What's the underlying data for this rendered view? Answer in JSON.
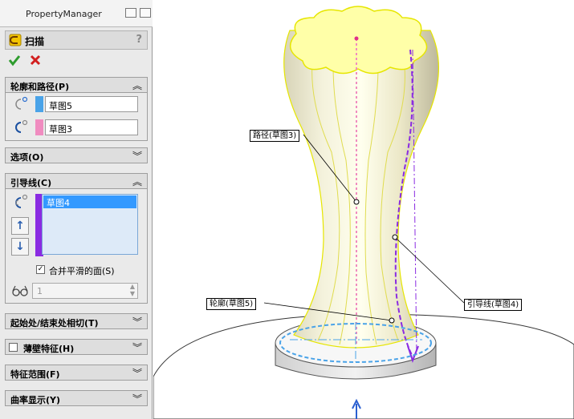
{
  "property_manager": {
    "title": "PropertyManager",
    "feature_name": "扫描",
    "help_label": "?",
    "sections": {
      "profile_path": {
        "title": "轮廓和路径(P)",
        "profile_value": "草图5",
        "path_value": "草图3"
      },
      "options": {
        "title": "选项(O)"
      },
      "guide_curves": {
        "title": "引导线(C)",
        "items": [
          "草图4"
        ],
        "merge_smooth_faces_label": "合并平滑的面(S)",
        "merge_smooth_faces_checked": true,
        "spinner_value": "1"
      },
      "tangency": {
        "title": "起始处/结束处相切(T)"
      },
      "thin_feature": {
        "title": "薄壁特征(H)",
        "checked": false
      },
      "feature_scope": {
        "title": "特征范围(F)"
      },
      "curvature_display": {
        "title": "曲率显示(Y)"
      }
    }
  },
  "viewport": {
    "callouts": {
      "path": "路径(草图3)",
      "profile": "轮廓(草图5)",
      "guide": "引导线(草图4)"
    }
  },
  "colors": {
    "profile_swatch": "#4aa3e8",
    "path_swatch": "#f08cc0",
    "guide_swatch": "#8a2be2",
    "ok_green": "#2e9c2e",
    "cancel_red": "#d21f1f"
  },
  "icons": [
    "sweep-icon",
    "ok-checkmark-icon",
    "cancel-x-icon",
    "profile-icon",
    "path-icon",
    "guide-curve-icon",
    "move-up-icon",
    "move-down-icon",
    "glasses-icon",
    "chevron-up-icon",
    "chevron-down-icon"
  ]
}
